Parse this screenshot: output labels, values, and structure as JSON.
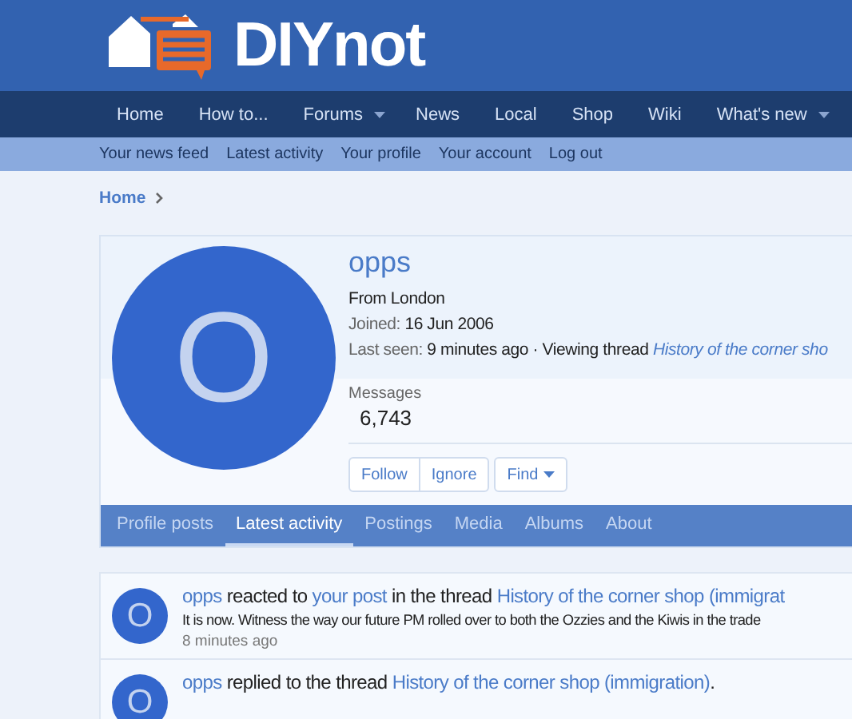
{
  "header": {
    "logo_text": "DIYnot"
  },
  "nav": [
    {
      "label": "Home",
      "has_menu": false
    },
    {
      "label": "How to...",
      "has_menu": false
    },
    {
      "label": "Forums",
      "has_menu": true
    },
    {
      "label": "News",
      "has_menu": false
    },
    {
      "label": "Local",
      "has_menu": false
    },
    {
      "label": "Shop",
      "has_menu": false
    },
    {
      "label": "Wiki",
      "has_menu": false
    },
    {
      "label": "What's new",
      "has_menu": true
    }
  ],
  "subnav": [
    "Your news feed",
    "Latest activity",
    "Your profile",
    "Your account",
    "Log out"
  ],
  "breadcrumb": [
    "Home"
  ],
  "profile": {
    "avatar_letter": "O",
    "name": "opps",
    "location": "From London",
    "joined_label": "Joined:",
    "joined": "16 Jun 2006",
    "last_seen_label": "Last seen:",
    "last_seen": "9 minutes ago · Viewing thread",
    "last_seen_thread": "History of the corner sho",
    "messages_label": "Messages",
    "messages": "6,743",
    "button_groups": [
      [
        {
          "label": "Follow",
          "has_menu": false
        },
        {
          "label": "Ignore",
          "has_menu": false
        }
      ],
      [
        {
          "label": "Find",
          "has_menu": true
        }
      ]
    ]
  },
  "tabs": [
    {
      "label": "Profile posts",
      "selected": false
    },
    {
      "label": "Latest activity",
      "selected": true
    },
    {
      "label": "Postings",
      "selected": false
    },
    {
      "label": "Media",
      "selected": false
    },
    {
      "label": "Albums",
      "selected": false
    },
    {
      "label": "About",
      "selected": false
    }
  ],
  "activity": [
    {
      "avatar_letter": "O",
      "parts": [
        {
          "kind": "link",
          "text": "opps"
        },
        {
          "kind": "text",
          "text": " reacted to "
        },
        {
          "kind": "link",
          "text": "your post"
        },
        {
          "kind": "text",
          "text": " in the thread "
        },
        {
          "kind": "link",
          "text": "History of the corner shop (immigrat"
        }
      ],
      "snippet": "It is now. Witness the way our future PM rolled over to both the Ozzies and the Kiwis in the trade",
      "time": "8 minutes ago"
    },
    {
      "avatar_letter": "O",
      "parts": [
        {
          "kind": "link",
          "text": "opps"
        },
        {
          "kind": "text",
          "text": " replied to the thread "
        },
        {
          "kind": "link",
          "text": "History of the corner shop (immigration)"
        },
        {
          "kind": "text",
          "text": "."
        }
      ]
    }
  ]
}
